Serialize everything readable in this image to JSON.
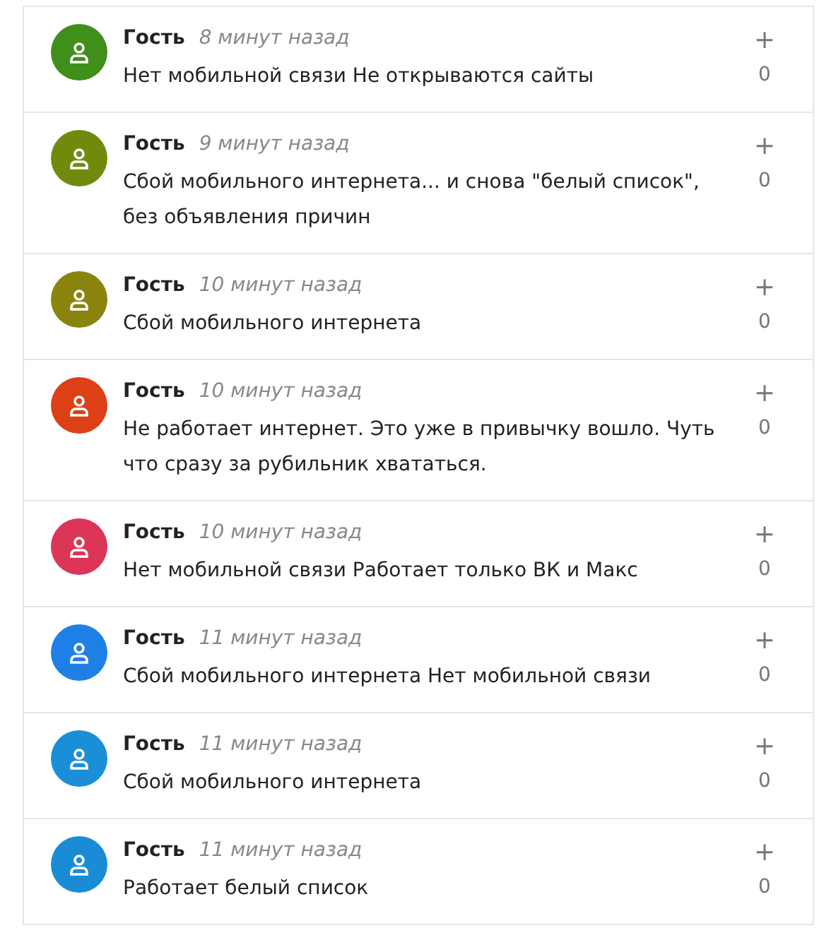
{
  "comments": [
    {
      "author": "Гость",
      "time": "8 минут назад",
      "text": "Нет мобильной связи Не открываются сайты",
      "color": "#3f8f1a",
      "vote": "+",
      "score": "0"
    },
    {
      "author": "Гость",
      "time": "9 минут назад",
      "text": "Сбой мобильного интернета... и снова \"белый список\", без объявления причин",
      "color": "#728a0c",
      "vote": "+",
      "score": "0"
    },
    {
      "author": "Гость",
      "time": "10 минут назад",
      "text": "Сбой мобильного интернета",
      "color": "#8a840e",
      "vote": "+",
      "score": "0"
    },
    {
      "author": "Гость",
      "time": "10 минут назад",
      "text": "Не работает интернет. Это уже в привычку вошло. Чуть что сразу за рубильник хвататься.",
      "color": "#dc4014",
      "vote": "+",
      "score": "0"
    },
    {
      "author": "Гость",
      "time": "10 минут назад",
      "text": "Нет мобильной связи Работает только ВК и Макс",
      "color": "#dc3558",
      "vote": "+",
      "score": "0"
    },
    {
      "author": "Гость",
      "time": "11 минут назад",
      "text": "Сбой мобильного интернета Нет мобильной связи",
      "color": "#1e80e6",
      "vote": "+",
      "score": "0"
    },
    {
      "author": "Гость",
      "time": "11 минут назад",
      "text": "Сбой мобильного интернета",
      "color": "#1a8fd8",
      "vote": "+",
      "score": "0"
    },
    {
      "author": "Гость",
      "time": "11 минут назад",
      "text": "Работает белый список",
      "color": "#1a8cd6",
      "vote": "+",
      "score": "0"
    }
  ]
}
